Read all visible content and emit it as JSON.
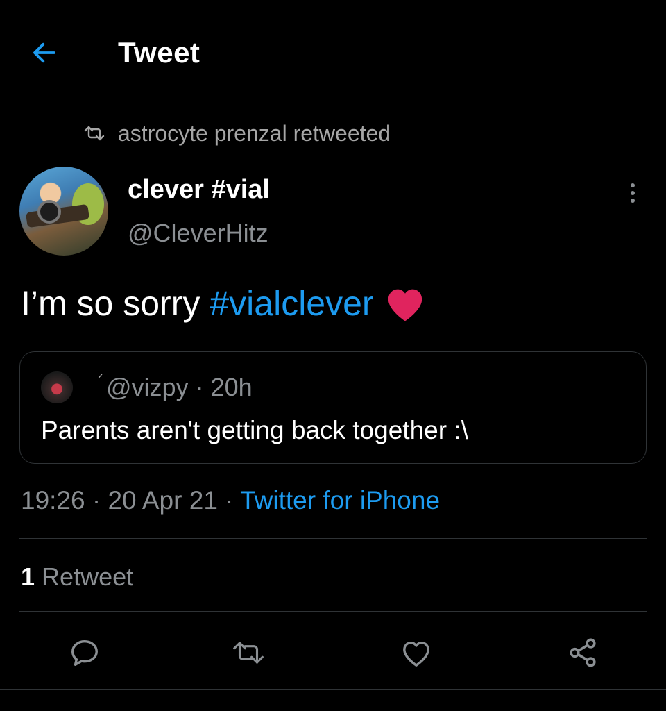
{
  "header": {
    "title": "Tweet",
    "back_icon": "arrow-left-icon"
  },
  "retweet_context": {
    "icon": "retweet-icon",
    "text": "astrocyte prenzal retweeted"
  },
  "author": {
    "name": "clever #vial",
    "handle": "@CleverHitz"
  },
  "tweet": {
    "text": "I’m so sorry",
    "hashtag": "#vialclever",
    "emoji": "red-heart-icon"
  },
  "quote": {
    "handle": "@vizpy",
    "time": "20h",
    "separator": "·",
    "mark": "ᐟ",
    "text": "Parents aren't getting back together :\\"
  },
  "meta": {
    "time": "19:26",
    "date": "20 Apr 21",
    "separator": "·",
    "source": "Twitter for iPhone"
  },
  "stats": {
    "retweets_count": "1",
    "retweets_label": "Retweet"
  },
  "actions": [
    "reply-icon",
    "retweet-icon",
    "like-icon",
    "share-icon"
  ],
  "colors": {
    "background": "#000000",
    "accent": "#1d9bf0",
    "heart": "#e0245e",
    "muted": "#8b8f93",
    "divider": "#2f3336"
  }
}
